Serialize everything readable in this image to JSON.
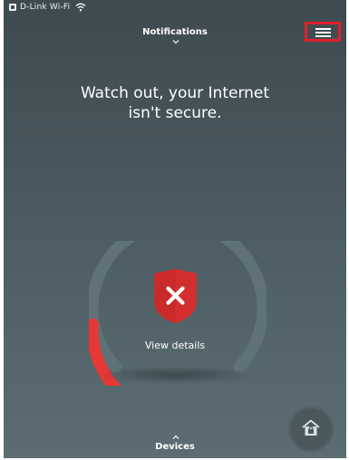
{
  "status_bar": {
    "carrier": "D-Link Wi-Fi",
    "icons": [
      "app-icon",
      "wifi-icon"
    ]
  },
  "header": {
    "title": "Notifications",
    "expand_icon": "chevron-down-icon",
    "menu_icon": "hamburger-menu-icon"
  },
  "alert": {
    "line1": "Watch out, your Internet",
    "line2": "isn't secure."
  },
  "security_gauge": {
    "status_icon": "shield-x-icon",
    "level_fraction": 0.18,
    "link_label": "View details",
    "colors": {
      "track": "#5f7277",
      "risk": "#e53935",
      "shield": "#d32f2f"
    }
  },
  "footer": {
    "devices_label": "Devices",
    "devices_icon": "chevron-up-icon",
    "fab_icon": "house-lock-icon"
  }
}
